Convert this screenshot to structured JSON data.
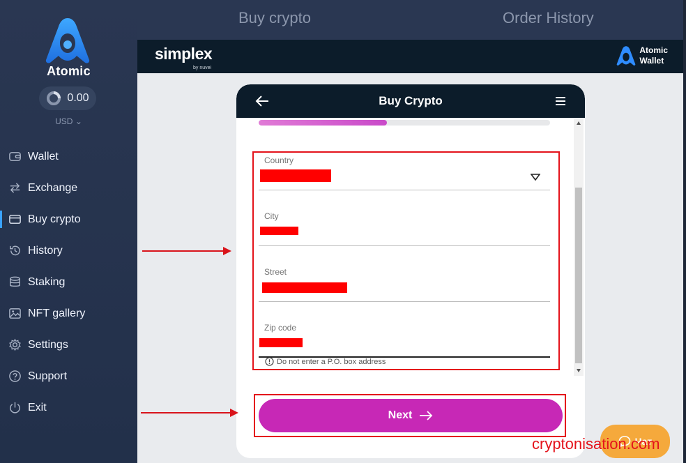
{
  "app": {
    "brand_name": "Atomic",
    "balance": "0.00",
    "currency": "USD",
    "nav": [
      {
        "label": "Wallet",
        "icon": "wallet-icon"
      },
      {
        "label": "Exchange",
        "icon": "exchange-icon"
      },
      {
        "label": "Buy crypto",
        "icon": "card-icon",
        "active": true
      },
      {
        "label": "History",
        "icon": "history-icon"
      },
      {
        "label": "Staking",
        "icon": "staking-icon"
      },
      {
        "label": "NFT gallery",
        "icon": "image-icon"
      },
      {
        "label": "Settings",
        "icon": "gear-icon"
      },
      {
        "label": "Support",
        "icon": "help-icon"
      },
      {
        "label": "Exit",
        "icon": "power-icon"
      }
    ]
  },
  "tabs": {
    "buy": "Buy crypto",
    "history": "Order History"
  },
  "provider": {
    "name": "simplex",
    "by": "by nuvei",
    "partner_line1": "Atomic",
    "partner_line2": "Wallet"
  },
  "widget": {
    "title": "Buy Crypto",
    "progress": 0.44,
    "fields": {
      "country_label": "Country",
      "city_label": "City",
      "street_label": "Street",
      "zip_label": "Zip code"
    },
    "hint": "Do not enter a P.O. box address",
    "next_label": "Next"
  },
  "chat": {
    "label": "Чат"
  },
  "watermark": "cryptonisation.com",
  "colors": {
    "accent": "#c728b6",
    "annotation_red": "#e4131b",
    "sidebar_active": "#3aa2ff"
  }
}
